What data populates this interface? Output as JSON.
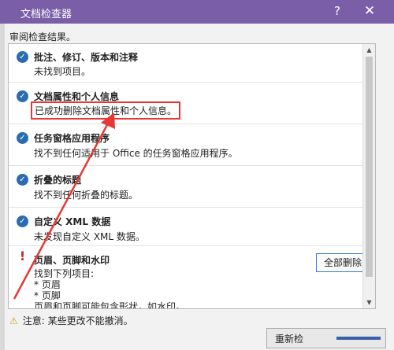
{
  "window": {
    "title": "文档检查器",
    "help_label": "?",
    "close_label": "✕"
  },
  "subtitle": "审阅检查结果。",
  "items": [
    {
      "title": "批注、修订、版本和注释",
      "desc": "未找到项目。",
      "status": "check"
    },
    {
      "title": "文档属性和个人信息",
      "desc": "已成功删除文档属性和个人信息。",
      "status": "check",
      "highlighted": true
    },
    {
      "title": "任务窗格应用程序",
      "desc": "找不到任何适用于 Office 的任务窗格应用程序。",
      "status": "check"
    },
    {
      "title": "折叠的标题",
      "desc": "找不到任何折叠的标题。",
      "status": "check"
    },
    {
      "title": "自定义 XML 数据",
      "desc": "未发现自定义 XML 数据。",
      "status": "check"
    },
    {
      "title": "页眉、页脚和水印",
      "desc_lines": [
        "找到下列项目:",
        "* 页眉",
        "* 页脚",
        "页眉和页脚可能包含形状，如水印。"
      ],
      "status": "warning"
    }
  ],
  "remove_all_label": "全部删除",
  "footer_note": "注意: 某些更改不能撤消。",
  "reinspect_label": "重新检",
  "colors": {
    "titlebar": "#7a5fa8",
    "check": "#2b6cb0",
    "warning": "#c62828",
    "highlight": "#e53935"
  }
}
